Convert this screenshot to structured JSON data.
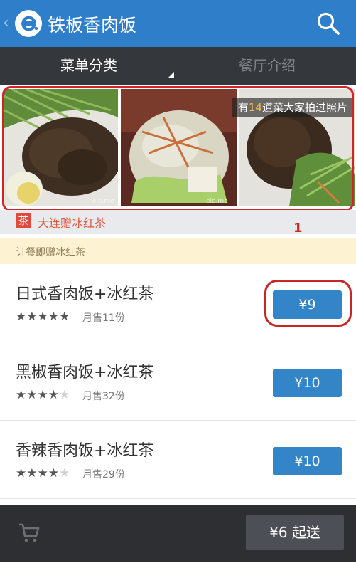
{
  "header": {
    "back_glyph": "‹",
    "title": "铁板香肉饭",
    "bg_color": "#2f7ec9"
  },
  "tabs": [
    {
      "label": "菜单分类",
      "active": true
    },
    {
      "label": "餐厅介绍",
      "active": false
    }
  ],
  "photos": {
    "caption_prefix": "有",
    "caption_count": "14",
    "caption_suffix": "道菜大家拍过照片",
    "watermark": "ele.me",
    "count": 3
  },
  "annotations": {
    "label_1": "1"
  },
  "promo": {
    "badge": "茶",
    "text": "大连赠冰红茶"
  },
  "notice": {
    "text": "订餐即赠冰红茶"
  },
  "menu_items": [
    {
      "name": "日式香肉饭+冰红茶",
      "rating": 5,
      "sales": "月售11份",
      "price": "¥9"
    },
    {
      "name": "黑椒香肉饭+冰红茶",
      "rating": 4,
      "sales": "月售32份",
      "price": "¥10"
    },
    {
      "name": "香辣香肉饭+冰红茶",
      "rating": 4,
      "sales": "月售29份",
      "price": "¥10"
    }
  ],
  "footer": {
    "cart_icon": "cart-icon",
    "checkout_label": "¥6 起送"
  }
}
